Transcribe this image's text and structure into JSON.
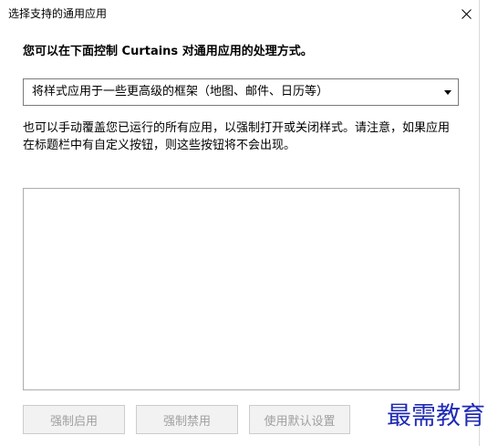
{
  "window": {
    "title": "选择支持的通用应用",
    "close_icon": "close-icon"
  },
  "heading": "您可以在下面控制 Curtains 对通用应用的处理方式。",
  "dropdown": {
    "selected": "将样式应用于一些更高级的框架（地图、邮件、日历等）",
    "arrow_icon": "caret-down-icon"
  },
  "description": "也可以手动覆盖您已运行的所有应用，以强制打开或关闭样式。请注意，如果应用在标题栏中有自定义按钮，则这些按钮将不会出现。",
  "app_list": {
    "items": []
  },
  "buttons": {
    "force_enable": "强制启用",
    "force_disable": "强制禁用",
    "use_default": "使用默认设置"
  },
  "watermark": "最需教育",
  "colors": {
    "watermark": "#1f2bb5",
    "disabled_text": "#a0a0a0",
    "button_bg": "#f2f2f2"
  }
}
